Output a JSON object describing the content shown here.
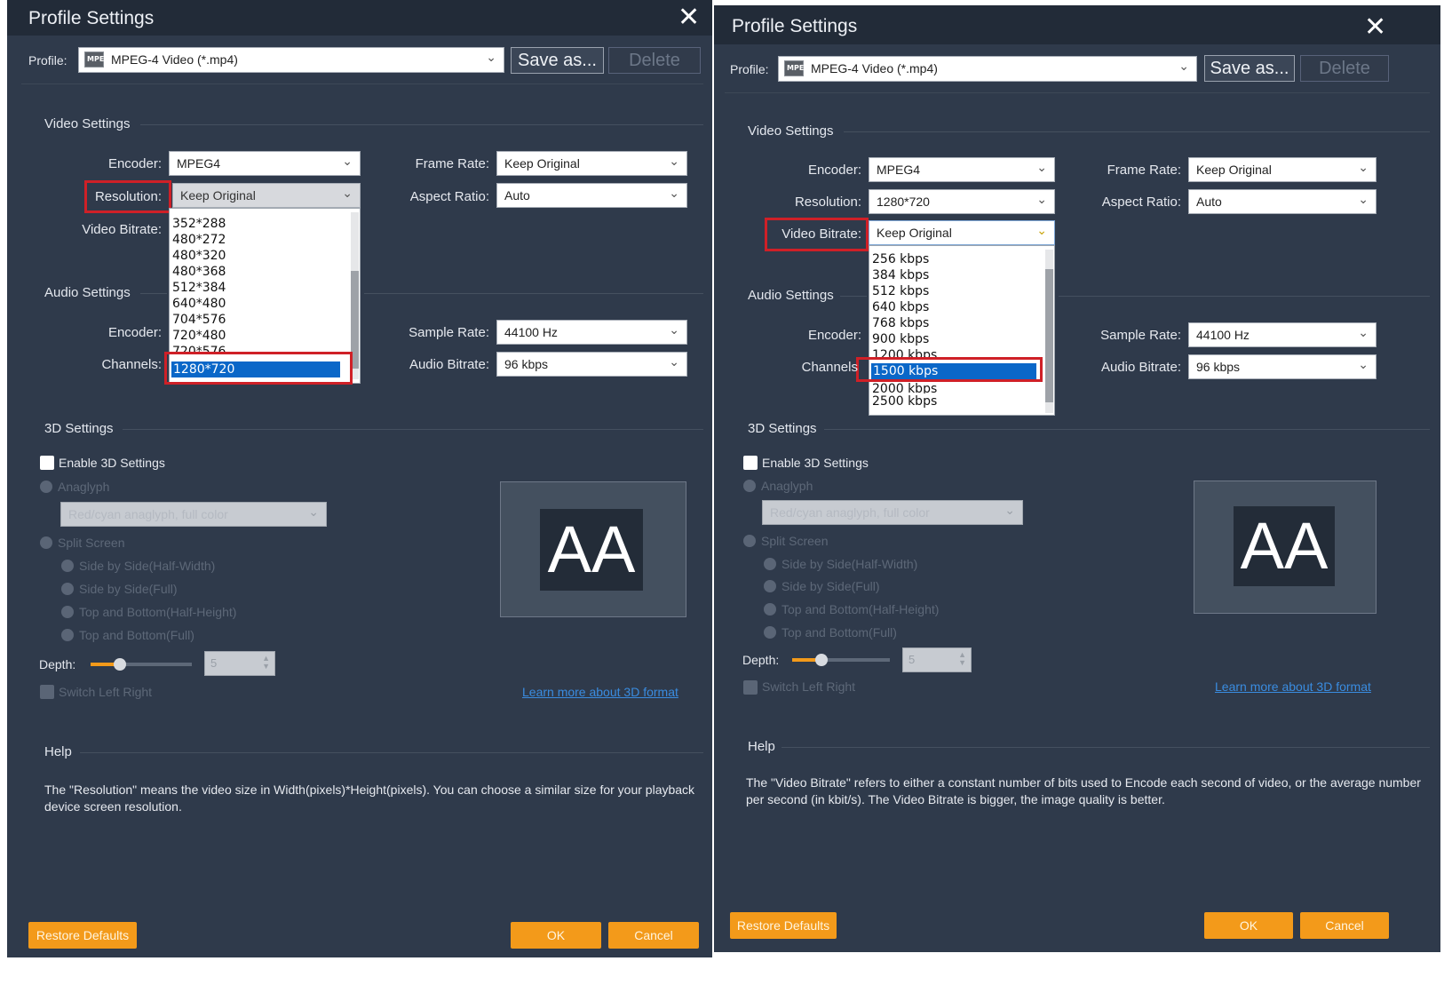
{
  "left": {
    "title": "Profile Settings",
    "profile_label": "Profile:",
    "profile_value": "MPEG-4 Video (*.mp4)",
    "save_as": "Save as...",
    "delete": "Delete",
    "video_section": "Video Settings",
    "encoder_label": "Encoder:",
    "encoder_value": "MPEG4",
    "resolution_label": "Resolution:",
    "resolution_value": "Keep Original",
    "video_bitrate_label": "Video Bitrate:",
    "frame_rate_label": "Frame Rate:",
    "frame_rate_value": "Keep Original",
    "aspect_ratio_label": "Aspect Ratio:",
    "aspect_ratio_value": "Auto",
    "dropdown_items": [
      "352*288",
      "480*272",
      "480*320",
      "480*368",
      "512*384",
      "640*480",
      "704*576",
      "720*480",
      "720*576"
    ],
    "dropdown_selected": "1280*720",
    "audio_section": "Audio Settings",
    "audio_encoder_label": "Encoder:",
    "channels_label": "Channels:",
    "sample_rate_label": "Sample Rate:",
    "sample_rate_value": "44100 Hz",
    "audio_bitrate_label": "Audio Bitrate:",
    "audio_bitrate_value": "96 kbps",
    "threed_section": "3D Settings",
    "enable_3d": "Enable 3D Settings",
    "anaglyph": "Anaglyph",
    "anaglyph_value": "Red/cyan anaglyph, full color",
    "split_screen": "Split Screen",
    "split_options": [
      "Side by Side(Half-Width)",
      "Side by Side(Full)",
      "Top and Bottom(Half-Height)",
      "Top and Bottom(Full)"
    ],
    "preview_text": "AA",
    "depth_label": "Depth:",
    "depth_value": "5",
    "depth_level": 0.25,
    "switch_lr": "Switch Left Right",
    "learn_more": "Learn more about 3D format",
    "help_section": "Help",
    "help_text": "The \"Resolution\" means the video size in Width(pixels)*Height(pixels).  You can choose a similar size for your playback device screen resolution.",
    "restore_defaults": "Restore Defaults",
    "ok": "OK",
    "cancel": "Cancel",
    "mp4_icon": "MPEG"
  },
  "right": {
    "title": "Profile Settings",
    "profile_label": "Profile:",
    "profile_value": "MPEG-4 Video (*.mp4)",
    "save_as": "Save as...",
    "delete": "Delete",
    "video_section": "Video Settings",
    "encoder_label": "Encoder:",
    "encoder_value": "MPEG4",
    "resolution_label": "Resolution:",
    "resolution_value": "1280*720",
    "video_bitrate_label": "Video Bitrate:",
    "video_bitrate_value": "Keep Original",
    "frame_rate_label": "Frame Rate:",
    "frame_rate_value": "Keep Original",
    "aspect_ratio_label": "Aspect Ratio:",
    "aspect_ratio_value": "Auto",
    "dropdown_items": [
      "256 kbps",
      "384 kbps",
      "512 kbps",
      "640 kbps",
      "768 kbps",
      "900 kbps",
      "1200 kbps"
    ],
    "dropdown_selected": "1500 kbps",
    "dropdown_after": [
      "2000 kbps",
      "2500 kbps"
    ],
    "audio_section": "Audio Settings",
    "audio_encoder_label": "Encoder:",
    "channels_label": "Channels",
    "sample_rate_label": "Sample Rate:",
    "sample_rate_value": "44100 Hz",
    "audio_bitrate_label": "Audio Bitrate:",
    "audio_bitrate_value": "96 kbps",
    "threed_section": "3D Settings",
    "enable_3d": "Enable 3D Settings",
    "anaglyph": "Anaglyph",
    "anaglyph_value": "Red/cyan anaglyph, full color",
    "split_screen": "Split Screen",
    "split_options": [
      "Side by Side(Half-Width)",
      "Side by Side(Full)",
      "Top and Bottom(Half-Height)",
      "Top and Bottom(Full)"
    ],
    "preview_text": "AA",
    "depth_label": "Depth:",
    "depth_value": "5",
    "depth_level": 0.25,
    "switch_lr": "Switch Left Right",
    "learn_more": "Learn more about 3D format",
    "help_section": "Help",
    "help_text": "The \"Video Bitrate\" refers to either a constant number of bits used to Encode each second of video, or the average number per second (in kbit/s). The Video Bitrate is bigger, the image quality is better.",
    "restore_defaults": "Restore Defaults",
    "ok": "OK",
    "cancel": "Cancel",
    "mp4_icon": "MPEG"
  },
  "icons": {
    "close": "close-icon",
    "chevron": "chevron-down-icon",
    "file": "mp4-file-icon"
  }
}
